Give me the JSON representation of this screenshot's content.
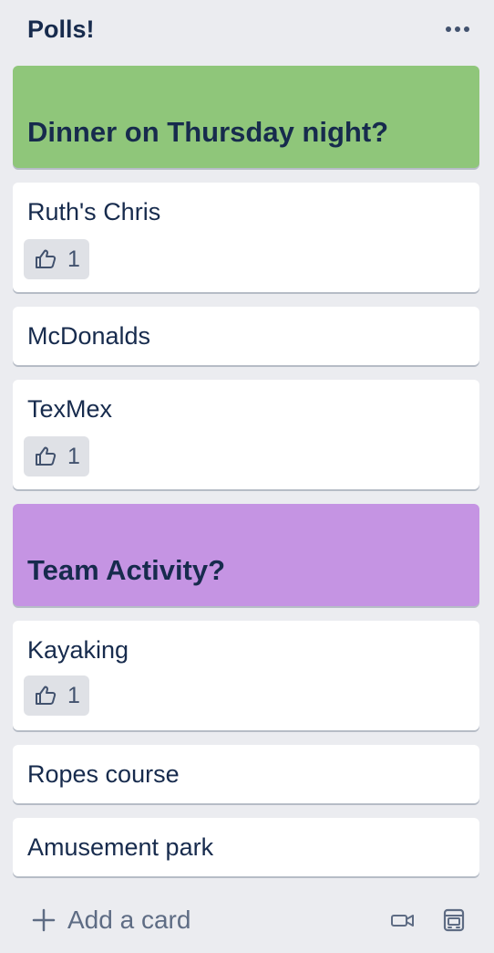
{
  "list": {
    "title": "Polls!",
    "menu_icon": "ellipsis-icon"
  },
  "polls": [
    {
      "question": "Dinner on Thursday night?",
      "cover_color": "#8fc67a",
      "options": [
        {
          "label": "Ruth's Chris",
          "votes": "1"
        },
        {
          "label": "McDonalds",
          "votes": null
        },
        {
          "label": "TexMex",
          "votes": "1"
        }
      ]
    },
    {
      "question": "Team Activity?",
      "cover_color": "#c594e3",
      "options": [
        {
          "label": "Kayaking",
          "votes": "1"
        },
        {
          "label": "Ropes course",
          "votes": null
        },
        {
          "label": "Amusement park",
          "votes": null
        }
      ]
    }
  ],
  "footer": {
    "add_card_label": "Add a card",
    "add_icon": "plus-icon",
    "icons": [
      "video-camera-icon",
      "template-icon"
    ]
  },
  "colors": {
    "background": "#ebecf0",
    "card": "#ffffff",
    "text": "#172b4d",
    "badge": "#dfe1e6",
    "muted": "#5e6c84"
  }
}
